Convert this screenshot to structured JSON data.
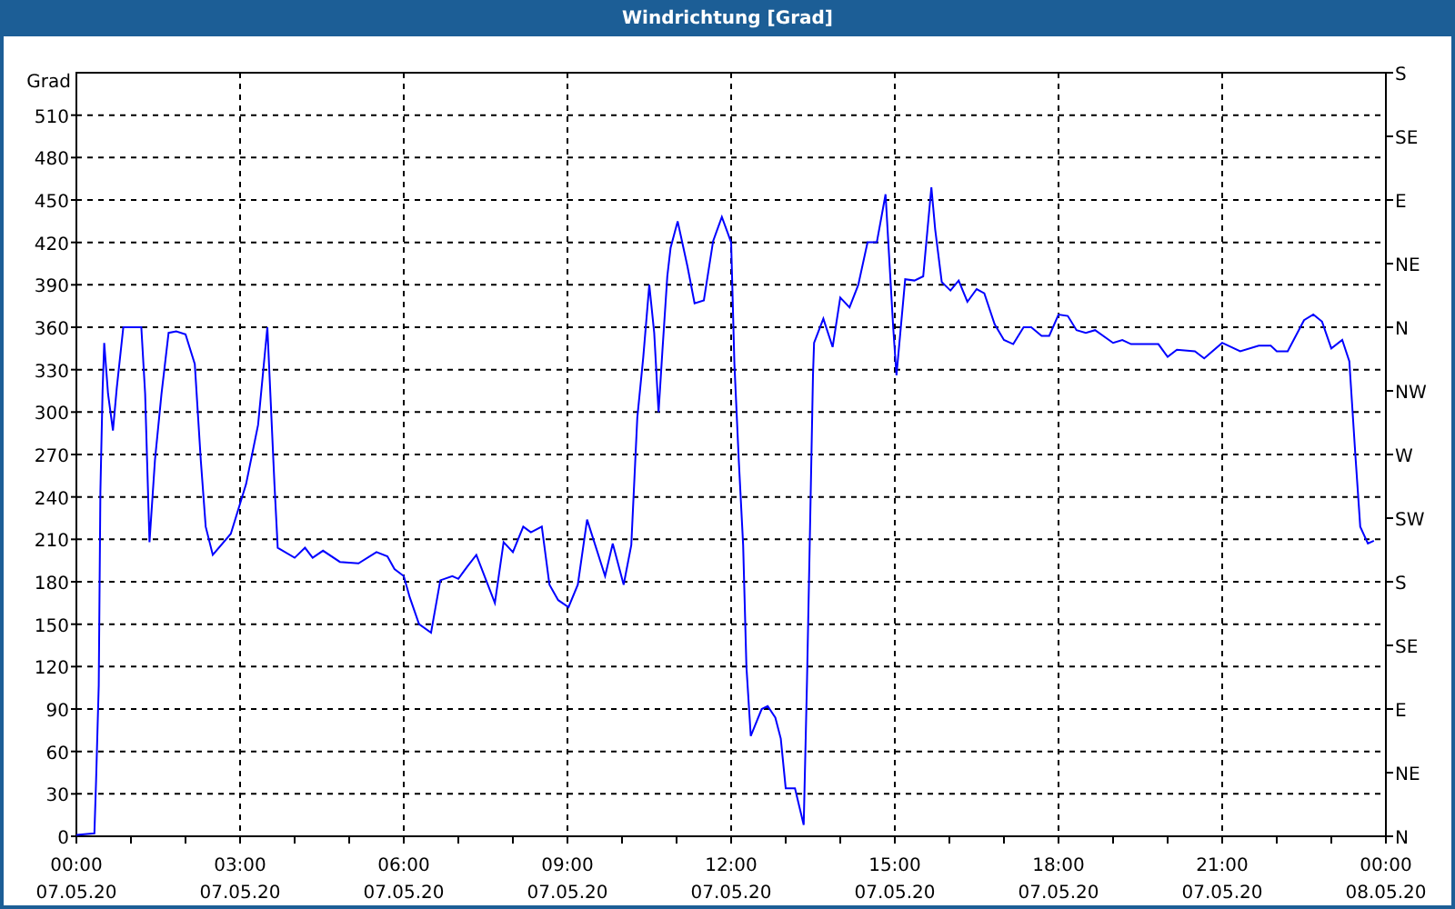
{
  "window": {
    "title": "Windrichtung [Grad]"
  },
  "chart": {
    "chart_data": {
      "type": "line",
      "ylabel": "Grad",
      "xlim": [
        0,
        24
      ],
      "ylim": [
        0,
        540
      ],
      "yticks": [
        0,
        30,
        60,
        90,
        120,
        150,
        180,
        210,
        240,
        270,
        300,
        330,
        360,
        390,
        420,
        450,
        480,
        510
      ],
      "grid": true,
      "xticks": [
        {
          "value": 0,
          "label": "00:00"
        },
        {
          "value": 3,
          "label": "03:00"
        },
        {
          "value": 6,
          "label": "06:00"
        },
        {
          "value": 9,
          "label": "09:00"
        },
        {
          "value": 12,
          "label": "12:00"
        },
        {
          "value": 15,
          "label": "15:00"
        },
        {
          "value": 18,
          "label": "18:00"
        },
        {
          "value": 21,
          "label": "21:00"
        },
        {
          "value": 24,
          "label": "00:00"
        }
      ],
      "series": [
        {
          "color": "#0000ff",
          "values": [
            1,
            2,
            38,
            107,
            244,
            315,
            349,
            313,
            287,
            317,
            360,
            360,
            313,
            208,
            266,
            313,
            356,
            357,
            355,
            334,
            266,
            219,
            199,
            214,
            249,
            291,
            360,
            249,
            204,
            197,
            204,
            197,
            202,
            194,
            193,
            201,
            198,
            189,
            184,
            169,
            150,
            144,
            181,
            184,
            182,
            191,
            199,
            182,
            165,
            208,
            201,
            219,
            215,
            219,
            178,
            167,
            162,
            178,
            224,
            184,
            207,
            178,
            206,
            296,
            339,
            390,
            356,
            300,
            343,
            396,
            416,
            435,
            403,
            377,
            379,
            421,
            438,
            420,
            334,
            266,
            206,
            120,
            71,
            90,
            92,
            84,
            69,
            34,
            34,
            8,
            109,
            206,
            326,
            349,
            366,
            346,
            381,
            374,
            390,
            420,
            420,
            454,
            360,
            326,
            394,
            393,
            396,
            459,
            429,
            392,
            386,
            393,
            378,
            387,
            384,
            362,
            351,
            348,
            360,
            360,
            354,
            354,
            369,
            368,
            358,
            356,
            358,
            349,
            351,
            348,
            348,
            339,
            344,
            343,
            338,
            349,
            343,
            347,
            347,
            343,
            343,
            365,
            369,
            364,
            345,
            351,
            336,
            270,
            219,
            207,
            209
          ]
        }
      ],
      "x": [
        0,
        0.33,
        0.36,
        0.41,
        0.44,
        0.48,
        0.51,
        0.58,
        0.67,
        0.74,
        0.86,
        1.19,
        1.26,
        1.34,
        1.44,
        1.56,
        1.69,
        1.83,
        2.0,
        2.17,
        2.28,
        2.37,
        2.5,
        2.83,
        3.11,
        3.33,
        3.5,
        3.63,
        3.69,
        4.0,
        4.19,
        4.33,
        4.52,
        4.83,
        5.17,
        5.5,
        5.7,
        5.83,
        6.0,
        6.11,
        6.28,
        6.5,
        6.67,
        6.89,
        7.0,
        7.17,
        7.33,
        7.5,
        7.67,
        7.83,
        8.0,
        8.19,
        8.33,
        8.53,
        8.67,
        8.83,
        9.02,
        9.19,
        9.36,
        9.69,
        9.83,
        10.03,
        10.17,
        10.28,
        10.39,
        10.5,
        10.59,
        10.67,
        10.74,
        10.83,
        10.89,
        11.02,
        11.2,
        11.33,
        11.5,
        11.67,
        11.83,
        12.0,
        12.06,
        12.14,
        12.22,
        12.28,
        12.36,
        12.56,
        12.67,
        12.81,
        12.91,
        13.0,
        13.17,
        13.33,
        13.39,
        13.44,
        13.5,
        13.52,
        13.69,
        13.86,
        14.0,
        14.17,
        14.33,
        14.5,
        14.67,
        14.83,
        14.97,
        15.03,
        15.19,
        15.36,
        15.52,
        15.67,
        15.74,
        15.86,
        16.02,
        16.17,
        16.33,
        16.5,
        16.64,
        16.83,
        17.0,
        17.17,
        17.36,
        17.5,
        17.69,
        17.83,
        18.0,
        18.17,
        18.33,
        18.5,
        18.67,
        19.0,
        19.17,
        19.33,
        19.83,
        20.0,
        20.17,
        20.5,
        20.67,
        21.0,
        21.33,
        21.67,
        21.89,
        22.0,
        22.2,
        22.5,
        22.67,
        22.83,
        23.0,
        23.2,
        23.33,
        23.44,
        23.53,
        23.67,
        23.78
      ]
    },
    "x_dates": [
      "07.05.20",
      "07.05.20",
      "07.05.20",
      "07.05.20",
      "07.05.20",
      "07.05.20",
      "07.05.20",
      "07.05.20",
      "08.05.20"
    ],
    "compass_ticks": [
      "S",
      "SE",
      "E",
      "NE",
      "N",
      "NW",
      "W",
      "SW",
      "S",
      "SE",
      "E",
      "NE",
      "N"
    ]
  }
}
